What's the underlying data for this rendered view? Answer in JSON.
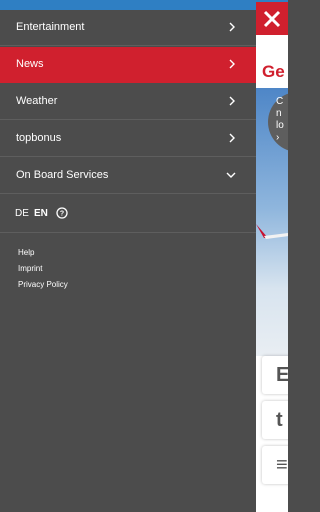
{
  "background": {
    "title_partial": "Ge",
    "circle_lines": [
      "C",
      "n",
      "lo",
      "›"
    ],
    "tiles": [
      "E",
      "t",
      "≡"
    ]
  },
  "menu": {
    "items": [
      {
        "label": "Entertainment",
        "state": "normal",
        "icon": "chevron-right-icon"
      },
      {
        "label": "News",
        "state": "active",
        "icon": "chevron-right-icon"
      },
      {
        "label": "Weather",
        "state": "normal",
        "icon": "chevron-right-icon"
      },
      {
        "label": "topbonus",
        "state": "normal",
        "icon": "chevron-right-icon"
      },
      {
        "label": "On Board Services",
        "state": "normal",
        "icon": "chevron-down-icon"
      }
    ],
    "languages": [
      "DE",
      "EN"
    ],
    "selected_language": "EN",
    "footer_links": [
      "Help",
      "Imprint",
      "Privacy Policy"
    ]
  },
  "colors": {
    "menu_bg": "#4c4c4c",
    "accent_red": "#d0202e",
    "status_blue": "#2f7fc3"
  }
}
